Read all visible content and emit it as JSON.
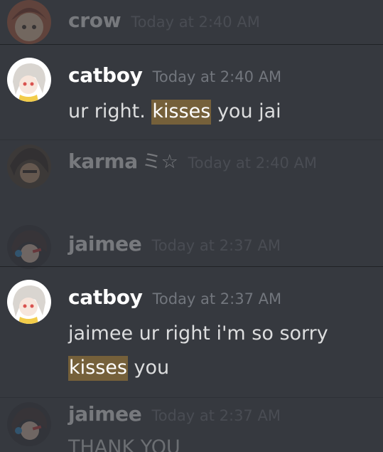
{
  "messages": [
    {
      "user": "crow",
      "time": "Today at 2:40 AM"
    },
    {
      "user": "catboy",
      "time": "Today at 2:40 AM",
      "text_before": "ur right. ",
      "highlight": "kisses",
      "text_after": " you jai"
    },
    {
      "user": "karma",
      "decoration": "ミ☆",
      "time": "Today at 2:40 AM"
    },
    {
      "user": "jaimee",
      "time": "Today at 2:37 AM"
    },
    {
      "user": "catboy",
      "time": "Today at 2:37 AM",
      "line1": "jaimee ur right i'm so sorry",
      "highlight": "kisses",
      "text_after": " you"
    },
    {
      "user": "jaimee",
      "time": "Today at 2:37 AM",
      "text": "THANK YOU"
    }
  ],
  "colors": {
    "background": "#36393f",
    "divider": "#202225",
    "username": "#ffffff",
    "timestamp": "#72767d",
    "text": "#dcddde",
    "highlight_bg": "#75603a"
  },
  "icons": {
    "avatars": [
      "crow-avatar",
      "catboy-avatar",
      "karma-avatar",
      "jaimee-avatar"
    ]
  }
}
